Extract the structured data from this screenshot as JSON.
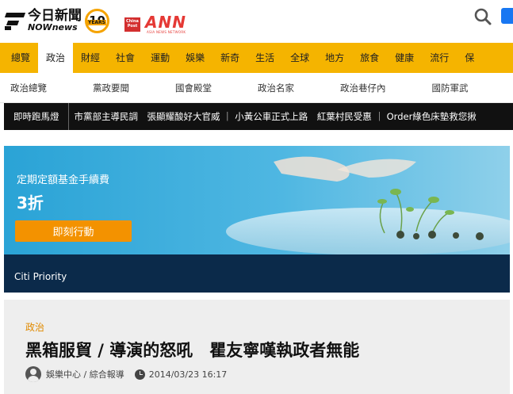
{
  "header": {
    "logo_zh": "今日新聞",
    "logo_en": "NOWnews",
    "years_badge": {
      "number": "10",
      "label": "YEARS"
    },
    "partner_chinapost": "China Post",
    "partner_ann": "ANN",
    "partner_ann_sub": "ASIA NEWS NETWORK",
    "icons": [
      "search-icon",
      "facebook-icon"
    ]
  },
  "main_nav": {
    "items": [
      "總覽",
      "政治",
      "財經",
      "社會",
      "運動",
      "娛樂",
      "新奇",
      "生活",
      "全球",
      "地方",
      "旅食",
      "健康",
      "流行",
      "保"
    ],
    "active_index": 1
  },
  "sub_nav": {
    "items": [
      "政治總覽",
      "黨政要聞",
      "國會殿堂",
      "政治名家",
      "政治巷仔內",
      "國防軍武"
    ]
  },
  "ticker": {
    "label": "即時跑馬燈",
    "text": "市黨部主導民調　張顯耀酸好大官威 ｜ 小黃公車正式上路　紅葉村民受惠 ｜ Order綠色床墊救您揪"
  },
  "ad": {
    "line1": "定期定額基金手續費",
    "line2": "3折",
    "cta": "即刻行動",
    "brand": "Citi Priority",
    "colors": {
      "background": "#2aa8d8",
      "cta": "#f39200",
      "footer": "#0b2a4a"
    }
  },
  "article": {
    "category": "政治",
    "title": "黑箱服貿 / 導演的怒吼　瞿友寧嘆執政者無能",
    "author": "娛樂中心 / 綜合報導",
    "datetime": "2014/03/23 16:17"
  },
  "colors": {
    "nav_yellow": "#f5b400",
    "category_orange": "#e08a00",
    "ticker_bg": "#111111"
  }
}
